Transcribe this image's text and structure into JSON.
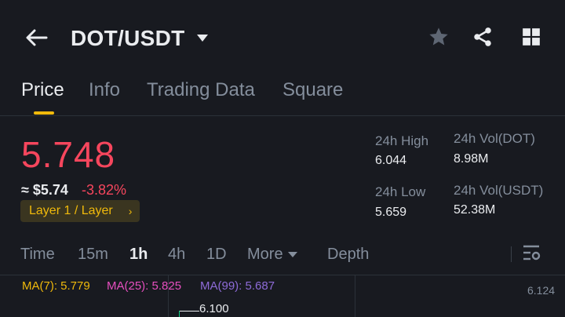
{
  "header": {
    "pair": "DOT/USDT",
    "icons": [
      "back-arrow-icon",
      "star-icon",
      "share-icon",
      "grid-icon"
    ]
  },
  "tabs": [
    {
      "label": "Price",
      "active": true
    },
    {
      "label": "Info",
      "active": false
    },
    {
      "label": "Trading Data",
      "active": false
    },
    {
      "label": "Square",
      "active": false
    }
  ],
  "price": {
    "last": "5.748",
    "fiat": "≈ $5.74",
    "change": "-3.82%",
    "tag": "Layer 1 / Layer"
  },
  "stats": {
    "high_label": "24h High",
    "high_value": "6.044",
    "low_label": "24h Low",
    "low_value": "5.659",
    "vol_base_label": "24h Vol(DOT)",
    "vol_base_value": "8.98M",
    "vol_quote_label": "24h Vol(USDT)",
    "vol_quote_value": "52.38M"
  },
  "intervals": {
    "time": "Time",
    "m15": "15m",
    "h1": "1h",
    "h4": "4h",
    "d1": "1D",
    "more": "More",
    "depth": "Depth",
    "active": "1h"
  },
  "chart": {
    "ma7": "MA(7): 5.779",
    "ma25": "MA(25): 5.825",
    "ma99": "MA(99): 5.687",
    "axis_top": "6.124",
    "price_marker": "6.100"
  },
  "colors": {
    "background": "#181a20",
    "up": "#0ecb81",
    "down": "#f6465d",
    "accent": "#f0b90b",
    "ma7": "#f0b90b",
    "ma25": "#e64fbf",
    "ma99": "#8e6bd8",
    "muted": "#848e9c"
  }
}
